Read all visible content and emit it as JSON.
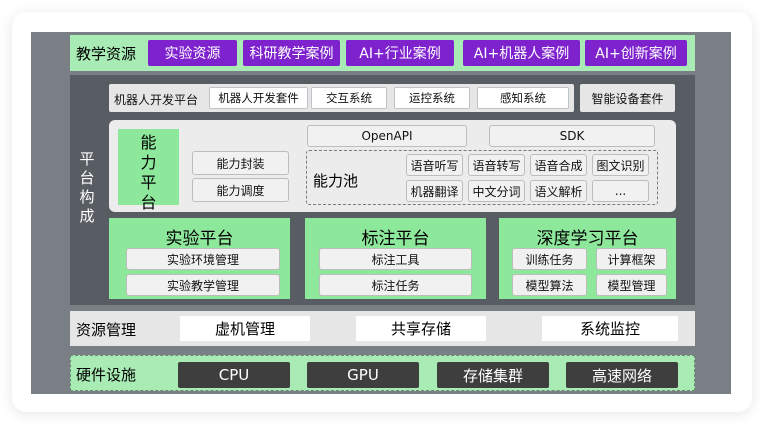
{
  "teaching_resources": {
    "label": "教学资源",
    "items": [
      "实验资源",
      "科研教学案例",
      "AI+行业案例",
      "AI+机器人案例",
      "AI+创新案例"
    ]
  },
  "platform": {
    "label": "平台构成",
    "top_row": [
      "机器人开发平台",
      "机器人开发套件",
      "交互系统",
      "运控系统",
      "感知系统",
      "智能设备套件"
    ],
    "capability": {
      "title": "能力平台",
      "items": [
        "能力封装",
        "能力调度"
      ],
      "pool_label": "能力池",
      "apis": [
        "OpenAPI",
        "SDK"
      ],
      "pool_items": [
        "语音听写",
        "语音转写",
        "语音合成",
        "图文识别",
        "机器翻译",
        "中文分词",
        "语义解析",
        "..."
      ]
    },
    "experiment": {
      "title": "实验平台",
      "items": [
        "实验环境管理",
        "实验教学管理"
      ]
    },
    "annotation": {
      "title": "标注平台",
      "items": [
        "标注工具",
        "标注任务"
      ]
    },
    "deep_learning": {
      "title": "深度学习平台",
      "items": [
        "训练任务",
        "计算框架",
        "模型算法",
        "模型管理"
      ]
    }
  },
  "resource_mgmt": {
    "label": "资源管理",
    "items": [
      "虚机管理",
      "共享存储",
      "系统监控"
    ]
  },
  "hardware": {
    "label": "硬件设施",
    "items": [
      "CPU",
      "GPU",
      "存储集群",
      "高速网络"
    ]
  }
}
